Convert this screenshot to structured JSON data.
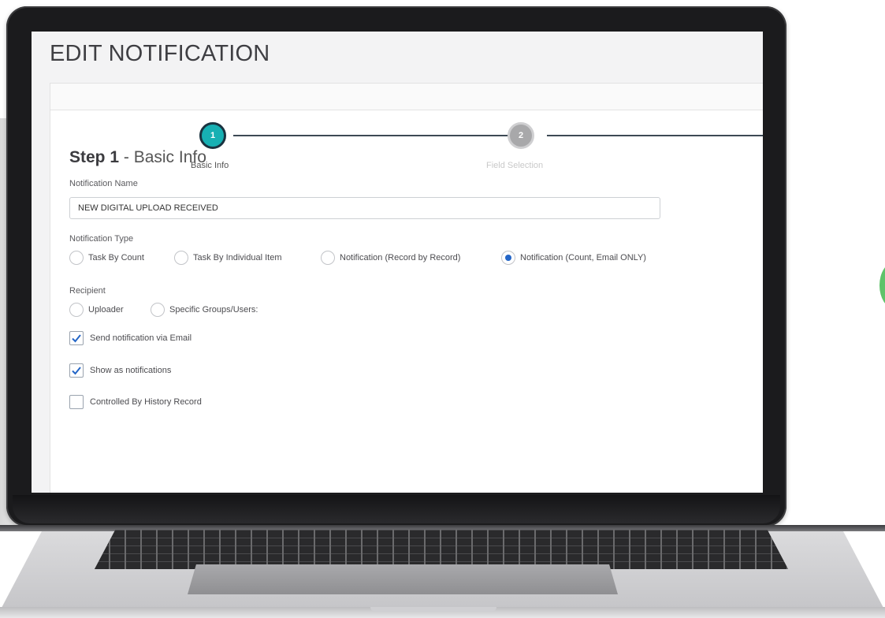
{
  "page": {
    "title": "EDIT NOTIFICATION"
  },
  "stepper": {
    "steps": [
      {
        "number": "1",
        "label": "Basic Info",
        "state": "active"
      },
      {
        "number": "2",
        "label": "Field Selection",
        "state": "inactive"
      }
    ],
    "accent_color": "#17b0b3"
  },
  "section": {
    "step_label": "Step 1",
    "separator": " - ",
    "title": "Basic Info"
  },
  "notification_name": {
    "label": "Notification Name",
    "value": "NEW DIGITAL UPLOAD RECEIVED"
  },
  "notification_type": {
    "label": "Notification Type",
    "options": [
      {
        "label": "Task By Count",
        "selected": false
      },
      {
        "label": "Task By Individual Item",
        "selected": false
      },
      {
        "label": "Notification (Record by Record)",
        "selected": false
      },
      {
        "label": "Notification (Count, Email ONLY)",
        "selected": true
      }
    ]
  },
  "recipient": {
    "label": "Recipient",
    "options": [
      {
        "label": "Uploader",
        "selected": false
      },
      {
        "label": "Specific Groups/Users:",
        "selected": false
      }
    ]
  },
  "checkboxes": [
    {
      "label": "Send notification via Email",
      "checked": true
    },
    {
      "label": "Show as notifications",
      "checked": true
    },
    {
      "label": "Controlled By History Record",
      "checked": false
    }
  ],
  "colors": {
    "radio_selected": "#2466c7",
    "check_mark": "#2466c7"
  }
}
